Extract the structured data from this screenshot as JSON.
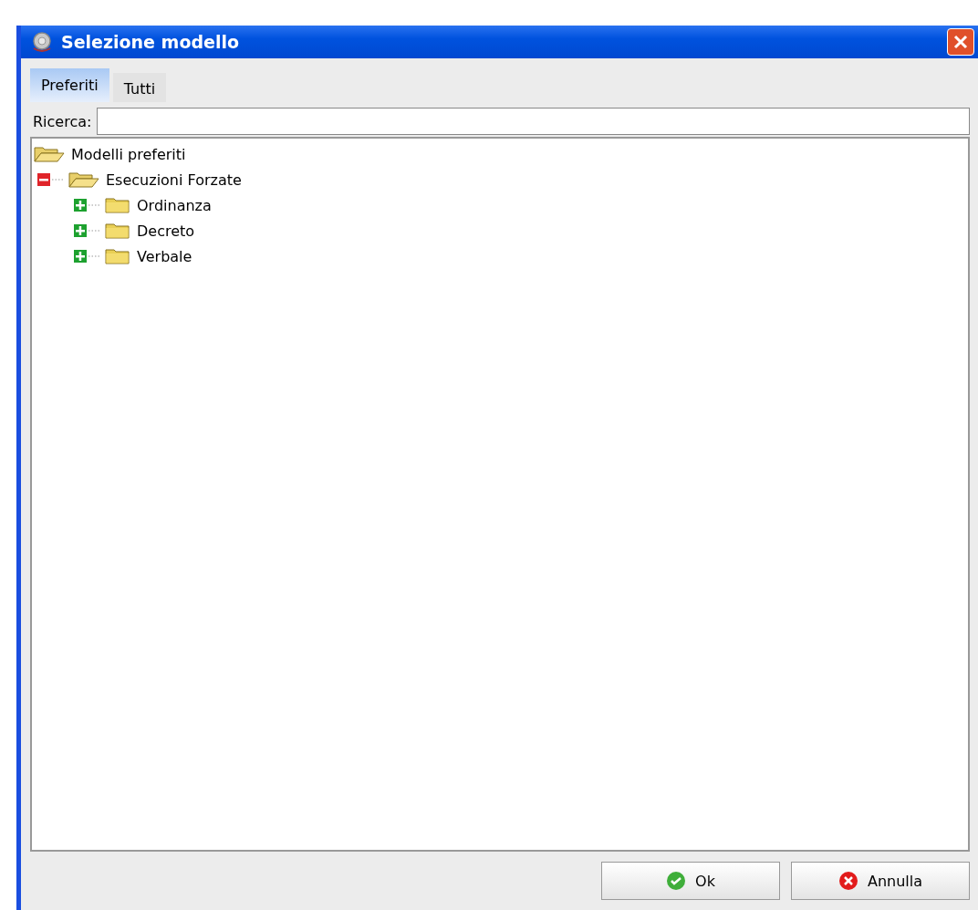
{
  "window": {
    "title": "Selezione modello"
  },
  "tabs": [
    {
      "label": "Preferiti",
      "selected": true
    },
    {
      "label": "Tutti",
      "selected": false
    }
  ],
  "search": {
    "label": "Ricerca:"
  },
  "tree": {
    "label": "Modelli preferiti",
    "expanded": true,
    "children": [
      {
        "label": "Esecuzioni Forzate",
        "expanded": true,
        "children": [
          {
            "label": "Ordinanza",
            "expanded": false
          },
          {
            "label": "Decreto",
            "expanded": false
          },
          {
            "label": "Verbale",
            "expanded": false
          }
        ]
      }
    ]
  },
  "buttons": [
    {
      "label": "Ok",
      "kind": "confirm"
    },
    {
      "label": "Annulla",
      "kind": "cancel"
    }
  ]
}
